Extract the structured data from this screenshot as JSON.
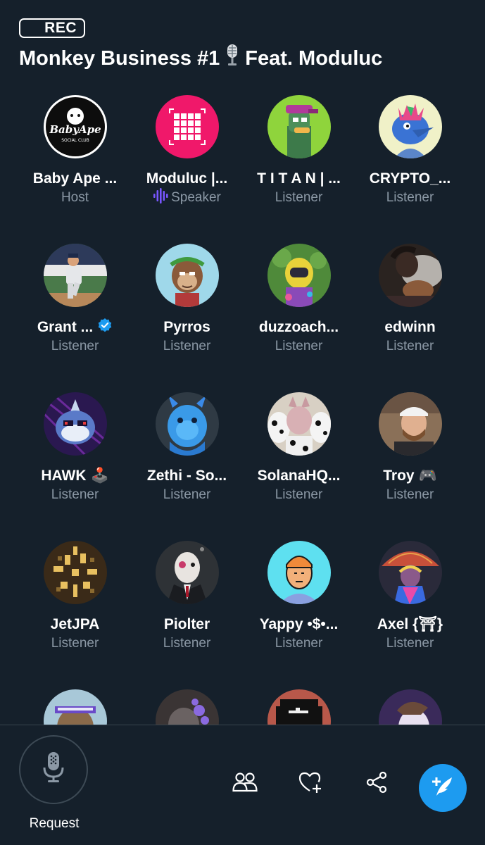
{
  "space": {
    "rec_label": "REC",
    "title_part1": "Monkey Business #1",
    "title_part2": "Feat. Moduluc"
  },
  "participants": [
    {
      "name": "Baby Ape ...",
      "role": "Host",
      "emoji": "",
      "avatar": "baby-ape-logo"
    },
    {
      "name": "Moduluc |...",
      "role": "Speaker",
      "emoji": "",
      "avatar": "moduluc-grid"
    },
    {
      "name": "T I T A N | ...",
      "role": "Listener",
      "emoji": "",
      "avatar": "green-duck"
    },
    {
      "name": "CRYPTO_...",
      "role": "Listener",
      "emoji": "",
      "avatar": "blue-bird"
    },
    {
      "name": "Grant ...",
      "role": "Listener",
      "emoji": "",
      "avatar": "baseball-player"
    },
    {
      "name": "Pyrros",
      "role": "Listener",
      "emoji": "",
      "avatar": "ape-laurel"
    },
    {
      "name": "duzzoach...",
      "role": "Listener",
      "emoji": "",
      "avatar": "hazmat-character"
    },
    {
      "name": "edwinn",
      "role": "Listener",
      "emoji": "",
      "avatar": "smoke-photo"
    },
    {
      "name": "HAWK",
      "role": "Listener",
      "emoji": "🕹️",
      "avatar": "robot-shark"
    },
    {
      "name": "Zethi - So...",
      "role": "Listener",
      "emoji": "",
      "avatar": "blue-monster"
    },
    {
      "name": "SolanaHQ...",
      "role": "Listener",
      "emoji": "",
      "avatar": "cat-dalmatians"
    },
    {
      "name": "Troy",
      "role": "Listener",
      "emoji": "🎮",
      "avatar": "man-cap"
    },
    {
      "name": "JetJPA",
      "role": "Listener",
      "emoji": "",
      "avatar": "pixel-burst"
    },
    {
      "name": "Piolter",
      "role": "Listener",
      "emoji": "",
      "avatar": "suit-character"
    },
    {
      "name": "Yappy •$•...",
      "role": "Listener",
      "emoji": "",
      "avatar": "beanie-character"
    },
    {
      "name": "Axel {⛩}",
      "role": "Listener",
      "emoji": "",
      "avatar": "umbrella-character"
    },
    {
      "name": "",
      "role": "",
      "emoji": "",
      "avatar": "headband-ape"
    },
    {
      "name": "",
      "role": "",
      "emoji": "",
      "avatar": "dark-character"
    },
    {
      "name": "",
      "role": "",
      "emoji": "",
      "avatar": "pixel-dark"
    },
    {
      "name": "",
      "role": "",
      "emoji": "",
      "avatar": "purple-character"
    }
  ],
  "controls": {
    "request_label": "Request",
    "icons": [
      "microphone-icon",
      "people-icon",
      "heart-plus-icon",
      "share-icon",
      "compose-tweet-icon"
    ]
  },
  "colors": {
    "background": "#15202b",
    "secondary_text": "#8b98a5",
    "speaker_accent": "#7856ff",
    "verified": "#1d9bf0",
    "fab": "#1d9bf0"
  }
}
